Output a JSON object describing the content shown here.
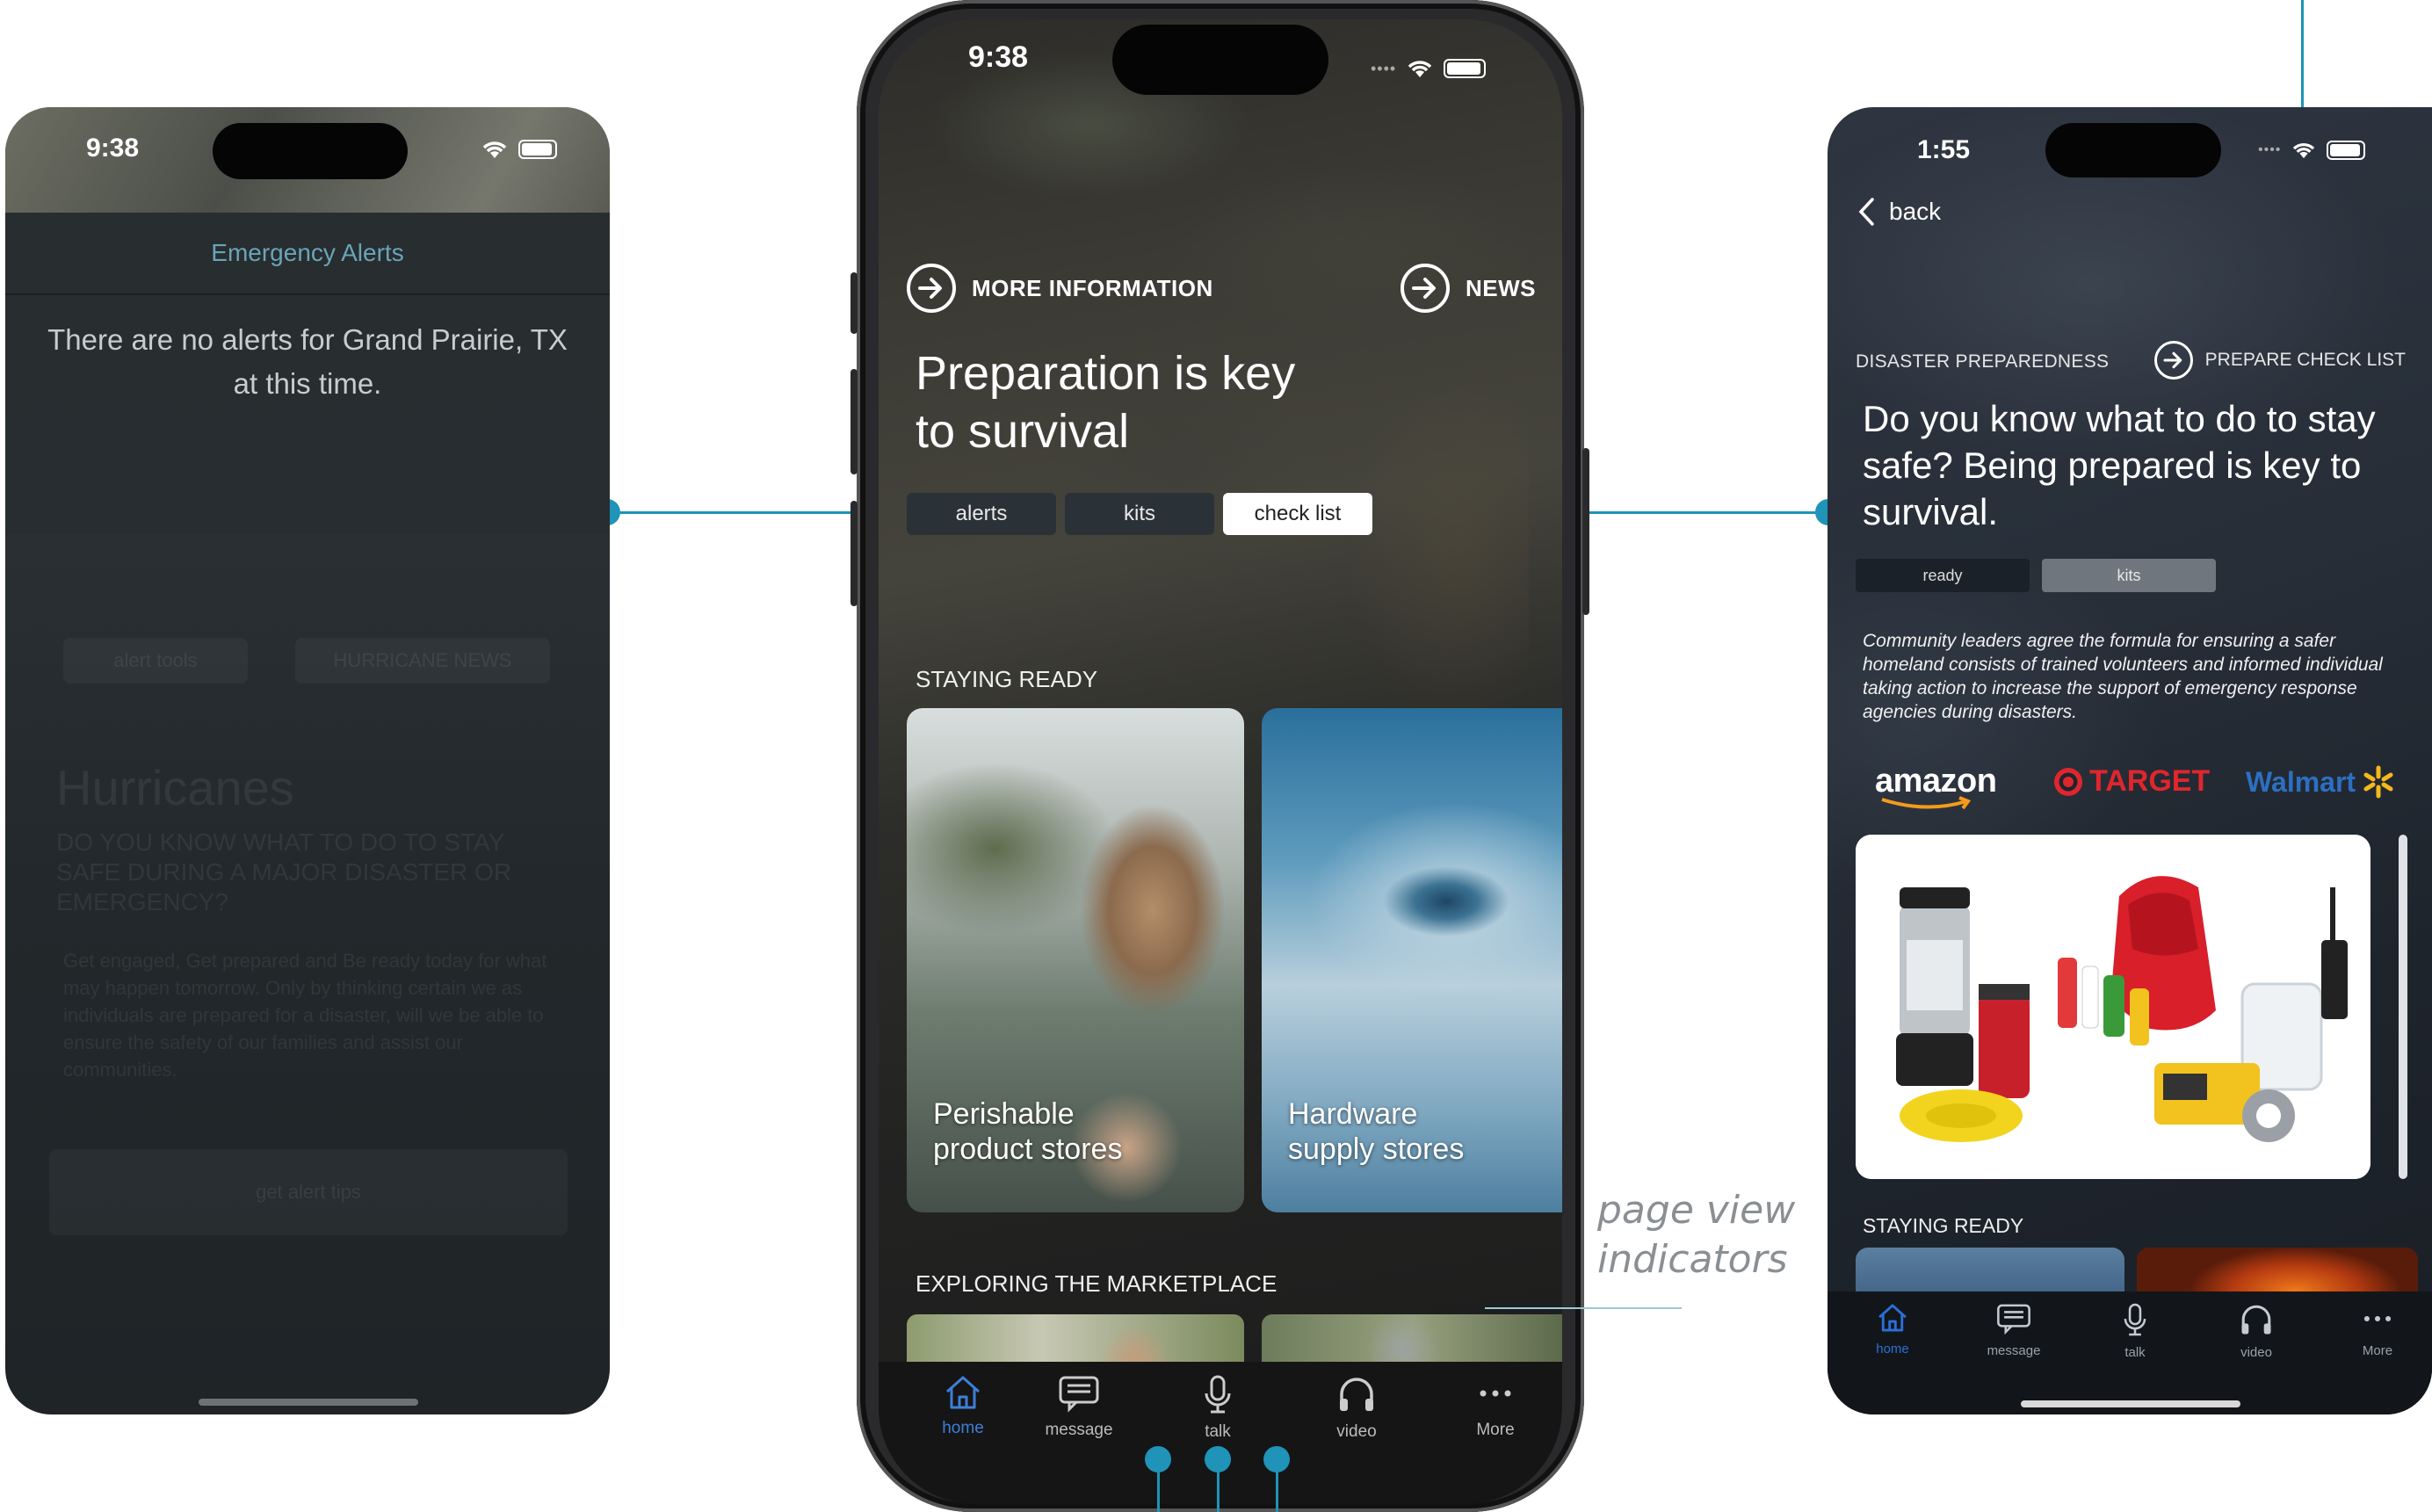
{
  "left_screen": {
    "time": "9:38",
    "alerts_title": "Emergency Alerts",
    "alerts_message": "There are no alerts for Grand Prairie, TX at this time.",
    "dim_buttons": [
      "alert tools",
      "HURRICANE NEWS"
    ],
    "dim_heading": "Hurricanes",
    "dim_subheading": "DO YOU KNOW WHAT TO DO TO STAY SAFE DURING A MAJOR DISASTER OR EMERGENCY?",
    "dim_body": "Get engaged, Get prepared and Be ready today for what may happen tomorrow. Only by thinking certain we as individuals are prepared for a disaster, will we be able to ensure the safety of our families and assist our communities.",
    "dim_cta": "get alert tips"
  },
  "center_screen": {
    "time": "9:38",
    "more_info": "MORE INFORMATION",
    "news": "NEWS",
    "headline_line1": "Preparation is key",
    "headline_line2": "to survival",
    "tabs": [
      "alerts",
      "kits",
      "check list"
    ],
    "section_staying_ready": "STAYING READY",
    "cards": [
      {
        "line1": "Perishable",
        "line2": "product stores"
      },
      {
        "line1": "Hardware",
        "line2": "supply stores"
      }
    ],
    "section_marketplace": "EXPLORING THE MARKETPLACE",
    "tabbar": [
      "home",
      "message",
      "talk",
      "video",
      "More"
    ]
  },
  "right_screen": {
    "time": "1:55",
    "back": "back",
    "category": "DISASTER PREPAREDNESS",
    "prepare_link": "PREPARE CHECK LIST",
    "headline": "Do you know what to do to stay safe? Being prepared is key to survival.",
    "pills": [
      "ready",
      "kits"
    ],
    "body": "Community leaders agree the formula for ensuring a safer homeland consists of trained volunteers and informed individual taking action to increase the support of emergency response agencies during disasters.",
    "logos": [
      "amazon",
      "TARGET",
      "Walmart"
    ],
    "section_staying_ready": "STAYING READY",
    "tabbar": [
      "home",
      "message",
      "talk",
      "video",
      "More"
    ]
  },
  "annotation": {
    "line1": "page view",
    "line2": "indicators"
  },
  "colors": {
    "connector": "#1f93b8",
    "active_tab": "#2b6fd6",
    "target_red": "#e0262d",
    "walmart_blue": "#2d6fc2",
    "walmart_yellow": "#f5b81c"
  }
}
